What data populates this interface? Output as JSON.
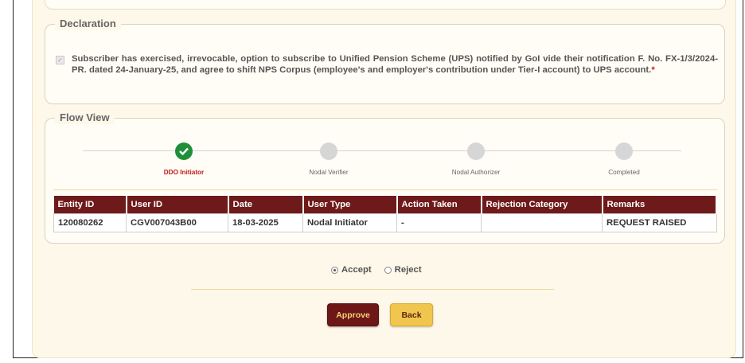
{
  "declaration": {
    "legend": "Declaration",
    "checked": true,
    "text": "Subscriber has exercised, irrevocable, option to subscribe to Unified Pension Scheme (UPS) notified by GoI vide their notification F. No. FX-1/3/2024-PR. dated 24-January-25, and agree to shift NPS Corpus (employee's and employer's contribution under Tier-I account) to UPS account.",
    "required_mark": "*"
  },
  "flow_view": {
    "legend": "Flow View",
    "steps": [
      {
        "label": "DDO Initiator",
        "status": "completed",
        "icon": "check-icon"
      },
      {
        "label": "Nodal Verifier",
        "status": "pending"
      },
      {
        "label": "Nodal Authorizer",
        "status": "pending"
      },
      {
        "label": "Completed",
        "status": "pending"
      }
    ],
    "table": {
      "headers": [
        "Entity ID",
        "User ID",
        "Date",
        "User Type",
        "Action Taken",
        "Rejection Category",
        "Remarks"
      ],
      "rows": [
        [
          "120080262",
          "CGV007043B00",
          "18-03-2025",
          "Nodal Initiator",
          "-",
          "",
          "REQUEST RAISED"
        ]
      ]
    }
  },
  "decision": {
    "options": [
      {
        "label": "Accept",
        "selected": true
      },
      {
        "label": "Reject",
        "selected": false
      }
    ]
  },
  "buttons": {
    "approve": "Approve",
    "back": "Back"
  },
  "colors": {
    "header_bg": "#6f1a1a",
    "approve_bg": "#6e1717",
    "back_bg": "#f1c64e",
    "active_step": "#c21a1a",
    "completed_step": "#1f8f3a",
    "page_bg": "#fdf8e9"
  }
}
